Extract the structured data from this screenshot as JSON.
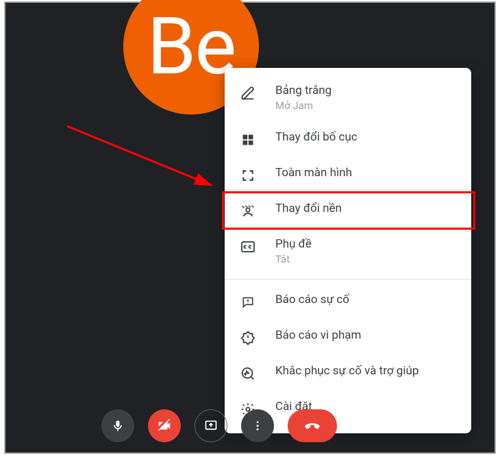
{
  "avatar": {
    "initials": "Be"
  },
  "menu": {
    "whiteboard": {
      "label": "Bảng trắng",
      "sub": "Mở Jam"
    },
    "layout": {
      "label": "Thay đổi bố cục"
    },
    "fullscreen": {
      "label": "Toàn màn hình"
    },
    "background": {
      "label": "Thay đổi nền"
    },
    "captions": {
      "label": "Phụ đề",
      "sub": "Tắt"
    },
    "report": {
      "label": "Báo cáo sự cố"
    },
    "abuse": {
      "label": "Báo cáo vi phạm"
    },
    "help": {
      "label": "Khắc phục sự cố và trợ giúp"
    },
    "settings": {
      "label": "Cài đặt"
    }
  }
}
